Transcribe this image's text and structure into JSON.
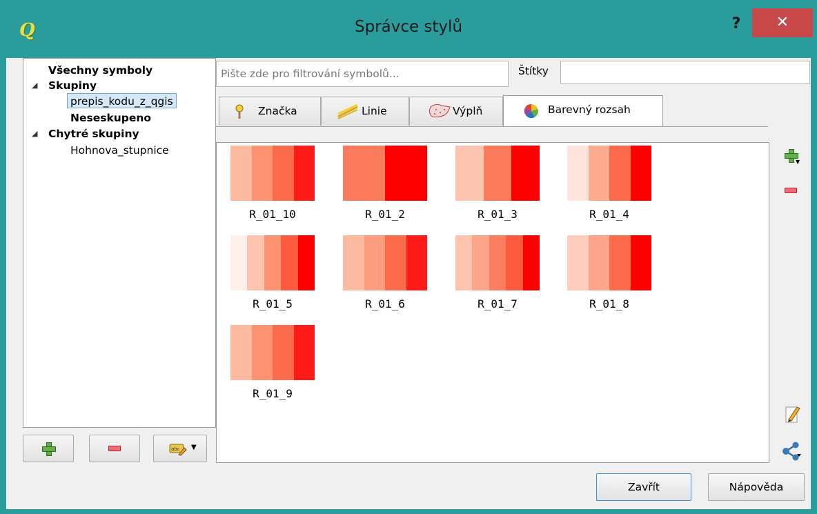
{
  "window": {
    "title": "Správce stylů",
    "help": "?",
    "close": "✕"
  },
  "tree": {
    "all_symbols": "Všechny symboly",
    "groups": "Skupiny",
    "group_item": "prepis_kodu_z_qgis",
    "ungrouped": "Neseskupeno",
    "smart_groups": "Chytré skupiny",
    "smart_item": "Hohnova_stupnice"
  },
  "filter": {
    "placeholder": "Pište zde pro filtrování symbolů...",
    "tags_label": "Štítky",
    "tags_value": ""
  },
  "tabs": [
    {
      "label": "Značka",
      "icon": "marker-icon"
    },
    {
      "label": "Linie",
      "icon": "line-icon"
    },
    {
      "label": "Výplň",
      "icon": "fill-icon"
    },
    {
      "label": "Barevný rozsah",
      "icon": "color-wheel-icon",
      "active": true
    }
  ],
  "ramps": [
    {
      "name": "R_01_10",
      "colors": [
        "#fcbba1",
        "#fc9272",
        "#fb6a4a",
        "#ff1a1a"
      ]
    },
    {
      "name": "R_01_2",
      "colors": [
        "#fc7b5c",
        "#ff0000"
      ]
    },
    {
      "name": "R_01_3",
      "colors": [
        "#fdc5b0",
        "#fc7b5c",
        "#ff0000"
      ]
    },
    {
      "name": "R_01_4",
      "colors": [
        "#fee4dc",
        "#fcab8f",
        "#fb6a4a",
        "#ff0000"
      ]
    },
    {
      "name": "R_01_5",
      "colors": [
        "#fff0ea",
        "#fdc5b0",
        "#fc9272",
        "#fb5a3f",
        "#ff0000"
      ]
    },
    {
      "name": "R_01_6",
      "colors": [
        "#fcbba1",
        "#fc9d80",
        "#fb6a4a",
        "#ff1a1a"
      ]
    },
    {
      "name": "R_01_7",
      "colors": [
        "#fdc5b0",
        "#fca58a",
        "#fb7e60",
        "#fb5a3f",
        "#ff0000"
      ]
    },
    {
      "name": "R_01_8",
      "colors": [
        "#fdcdbd",
        "#fca58a",
        "#fb6a4a",
        "#ff0000"
      ]
    },
    {
      "name": "R_01_9",
      "colors": [
        "#fcbba1",
        "#fc9272",
        "#fb6a4a",
        "#ff1a1a"
      ]
    }
  ],
  "buttons": {
    "close": "Zavřít",
    "help": "Nápověda"
  },
  "colors": {
    "title_bar": "#2b9c9c",
    "close_button": "#c7494a",
    "selection": "#d5e8f7"
  }
}
